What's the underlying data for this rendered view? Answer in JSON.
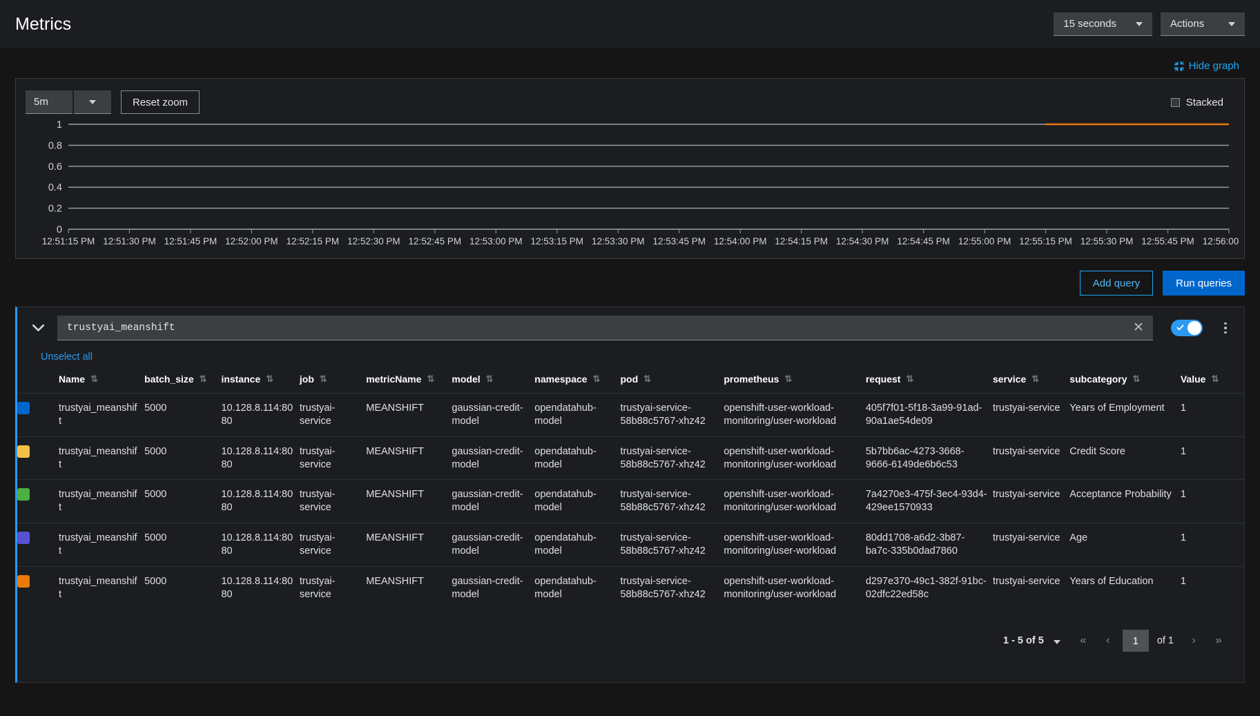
{
  "header": {
    "title": "Metrics",
    "refresh_interval": "15 seconds",
    "actions_label": "Actions"
  },
  "graph": {
    "hide_graph_label": "Hide graph",
    "hide_graph_icon": "compress-icon",
    "span_value": "5m",
    "reset_zoom_label": "Reset zoom",
    "stacked_label": "Stacked",
    "stacked_checked": false
  },
  "chart_data": {
    "type": "line",
    "title": "",
    "xlabel": "",
    "ylabel": "",
    "ylim": [
      0,
      1
    ],
    "yticks": [
      "0",
      "0.2",
      "0.4",
      "0.6",
      "0.8",
      "1"
    ],
    "grid": true,
    "legend": "none",
    "x": [
      "12:51:15 PM",
      "12:51:30 PM",
      "12:51:45 PM",
      "12:52:00 PM",
      "12:52:15 PM",
      "12:52:30 PM",
      "12:52:45 PM",
      "12:53:00 PM",
      "12:53:15 PM",
      "12:53:30 PM",
      "12:53:45 PM",
      "12:54:00 PM",
      "12:54:15 PM",
      "12:54:30 PM",
      "12:54:45 PM",
      "12:55:00 PM",
      "12:55:15 PM",
      "12:55:30 PM",
      "12:55:45 PM",
      "12:56:00 PM"
    ],
    "series": [
      {
        "name": "trustyai_meanshift",
        "color": "#ec7a08",
        "values": [
          1,
          1,
          1,
          1,
          1,
          1,
          1,
          1,
          1,
          1,
          1,
          1,
          1,
          1,
          1,
          1,
          1,
          1,
          1,
          1
        ],
        "visible_from_x": "12:55:15 PM"
      }
    ]
  },
  "query_actions": {
    "add_query_label": "Add query",
    "run_queries_label": "Run queries"
  },
  "query": {
    "expression": "trustyai_meanshift",
    "enabled": true,
    "collapse_icon": "chevron-down-icon",
    "clear_icon": "close-icon",
    "kebab_icon": "kebab-menu-icon",
    "unselect_all_label": "Unselect all"
  },
  "table": {
    "columns": [
      "Name",
      "batch_size",
      "instance",
      "job",
      "metricName",
      "model",
      "namespace",
      "pod",
      "prometheus",
      "request",
      "service",
      "subcategory",
      "Value"
    ],
    "rows": [
      {
        "color": "#0066cc",
        "Name": "trustyai_meanshift",
        "batch_size": "5000",
        "instance": "10.128.8.114:8080",
        "job": "trustyai-service",
        "metricName": "MEANSHIFT",
        "model": "gaussian-credit-model",
        "namespace": "opendatahub-model",
        "pod": "trustyai-service-58b88c5767-xhz42",
        "prometheus": "openshift-user-workload-monitoring/user-workload",
        "request": "405f7f01-5f18-3a99-91ad-90a1ae54de09",
        "service": "trustyai-service",
        "subcategory": "Years of Employment",
        "Value": "1"
      },
      {
        "color": "#f4c145",
        "Name": "trustyai_meanshift",
        "batch_size": "5000",
        "instance": "10.128.8.114:8080",
        "job": "trustyai-service",
        "metricName": "MEANSHIFT",
        "model": "gaussian-credit-model",
        "namespace": "opendatahub-model",
        "pod": "trustyai-service-58b88c5767-xhz42",
        "prometheus": "openshift-user-workload-monitoring/user-workload",
        "request": "5b7bb6ac-4273-3668-9666-6149de6b6c53",
        "service": "trustyai-service",
        "subcategory": "Credit Score",
        "Value": "1"
      },
      {
        "color": "#4cb140",
        "Name": "trustyai_meanshift",
        "batch_size": "5000",
        "instance": "10.128.8.114:8080",
        "job": "trustyai-service",
        "metricName": "MEANSHIFT",
        "model": "gaussian-credit-model",
        "namespace": "opendatahub-model",
        "pod": "trustyai-service-58b88c5767-xhz42",
        "prometheus": "openshift-user-workload-monitoring/user-workload",
        "request": "7a4270e3-475f-3ec4-93d4-429ee1570933",
        "service": "trustyai-service",
        "subcategory": "Acceptance Probability",
        "Value": "1"
      },
      {
        "color": "#5752d1",
        "Name": "trustyai_meanshift",
        "batch_size": "5000",
        "instance": "10.128.8.114:8080",
        "job": "trustyai-service",
        "metricName": "MEANSHIFT",
        "model": "gaussian-credit-model",
        "namespace": "opendatahub-model",
        "pod": "trustyai-service-58b88c5767-xhz42",
        "prometheus": "openshift-user-workload-monitoring/user-workload",
        "request": "80dd1708-a6d2-3b87-ba7c-335b0dad7860",
        "service": "trustyai-service",
        "subcategory": "Age",
        "Value": "1"
      },
      {
        "color": "#ec7a08",
        "Name": "trustyai_meanshift",
        "batch_size": "5000",
        "instance": "10.128.8.114:8080",
        "job": "trustyai-service",
        "metricName": "MEANSHIFT",
        "model": "gaussian-credit-model",
        "namespace": "opendatahub-model",
        "pod": "trustyai-service-58b88c5767-xhz42",
        "prometheus": "openshift-user-workload-monitoring/user-workload",
        "request": "d297e370-49c1-382f-91bc-02dfc22ed58c",
        "service": "trustyai-service",
        "subcategory": "Years of Education",
        "Value": "1"
      }
    ]
  },
  "pagination": {
    "range_label": "1 - 5 of 5",
    "page_value": "1",
    "of_label": "of 1",
    "first_icon": "double-chevron-left-icon",
    "prev_icon": "chevron-left-icon",
    "next_icon": "chevron-right-icon",
    "last_icon": "double-chevron-right-icon"
  },
  "colors": {
    "accent": "#2b9af3",
    "primary_button": "#0066cc",
    "background": "#151515",
    "panel": "#1b1d21"
  }
}
